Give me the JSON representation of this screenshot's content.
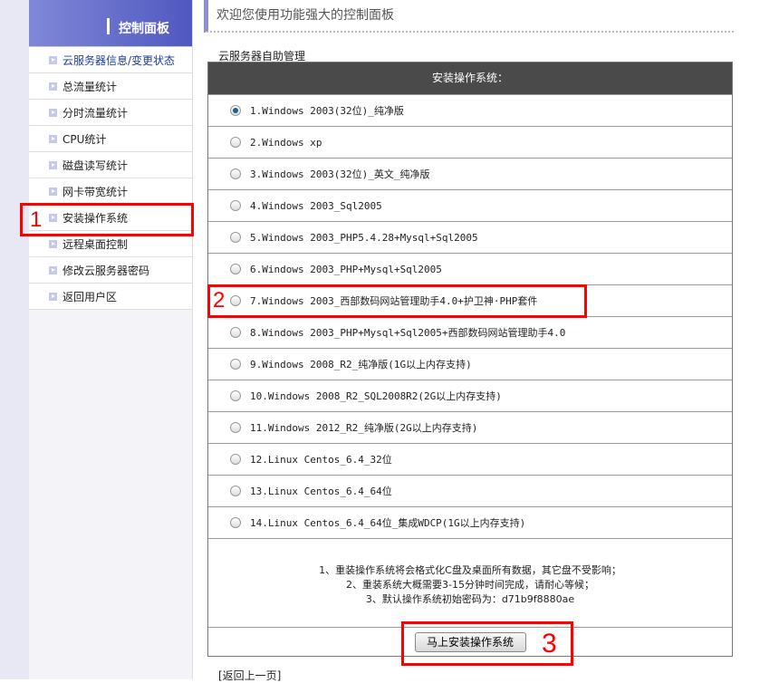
{
  "sidebar": {
    "title": "控制面板",
    "items": [
      {
        "label": "云服务器信息/变更状态"
      },
      {
        "label": "总流量统计"
      },
      {
        "label": "分时流量统计"
      },
      {
        "label": "CPU统计"
      },
      {
        "label": "磁盘读写统计"
      },
      {
        "label": "网卡带宽统计"
      },
      {
        "label": "安装操作系统"
      },
      {
        "label": "远程桌面控制"
      },
      {
        "label": "修改云服务器密码"
      },
      {
        "label": "返回用户区"
      }
    ]
  },
  "main": {
    "welcome": "欢迎您使用功能强大的控制面板",
    "subtitle": "云服务器自助管理",
    "table_header": "安装操作系统：",
    "options": [
      {
        "label": "1.Windows 2003(32位)_纯净版",
        "selected": true
      },
      {
        "label": "2.Windows xp",
        "selected": false
      },
      {
        "label": "3.Windows 2003(32位)_英文_纯净版",
        "selected": false
      },
      {
        "label": "4.Windows 2003_Sql2005",
        "selected": false
      },
      {
        "label": "5.Windows 2003_PHP5.4.28+Mysql+Sql2005",
        "selected": false
      },
      {
        "label": "6.Windows 2003_PHP+Mysql+Sql2005",
        "selected": false
      },
      {
        "label": "7.Windows 2003_西部数码网站管理助手4.0+护卫神·PHP套件",
        "selected": false
      },
      {
        "label": "8.Windows 2003_PHP+Mysql+Sql2005+西部数码网站管理助手4.0",
        "selected": false
      },
      {
        "label": "9.Windows 2008_R2_纯净版(1G以上内存支持)",
        "selected": false
      },
      {
        "label": "10.Windows 2008_R2_SQL2008R2(2G以上内存支持)",
        "selected": false
      },
      {
        "label": "11.Windows 2012_R2_纯净版(2G以上内存支持)",
        "selected": false
      },
      {
        "label": "12.Linux Centos_6.4_32位",
        "selected": false
      },
      {
        "label": "13.Linux Centos_6.4_64位",
        "selected": false
      },
      {
        "label": "14.Linux Centos_6.4_64位_集成WDCP(1G以上内存支持)",
        "selected": false
      }
    ],
    "notes": [
      "1、重装操作系统将会格式化C盘及桌面所有数据，其它盘不受影响；",
      "2、重装系统大概需要3-15分钟时间完成，请耐心等候；",
      "3、默认操作系统初始密码为：d71b9f8880ae"
    ],
    "install_button": "马上安装操作系统",
    "back_link": "[返回上一页]"
  },
  "annotations": [
    "1",
    "2",
    "3"
  ]
}
